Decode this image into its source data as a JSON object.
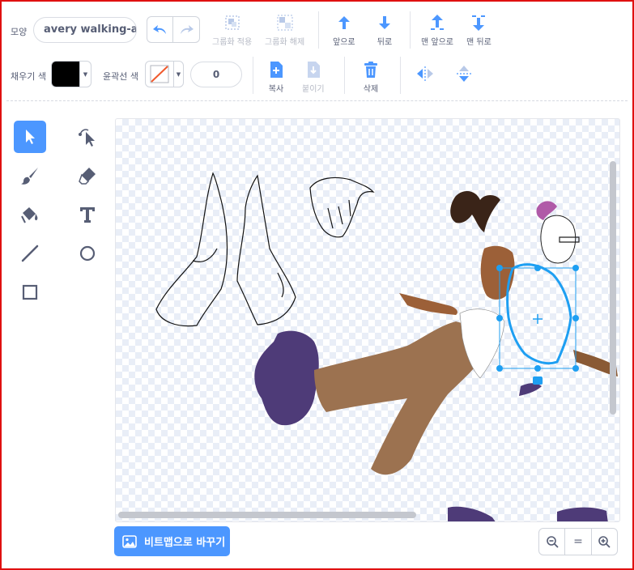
{
  "costume": {
    "label": "모양",
    "name": "avery walking-a"
  },
  "toolbar": {
    "group_label": "그룹화 적용",
    "ungroup_label": "그룹화 해제",
    "forward_label": "앞으로",
    "backward_label": "뒤로",
    "front_label": "맨 앞으로",
    "back_label": "맨 뒤로",
    "fill_label": "채우기 색",
    "outline_label": "윤곽선 색",
    "outline_width": "0",
    "copy_label": "복사",
    "paste_label": "붙이기",
    "delete_label": "삭제"
  },
  "colors": {
    "accent": "#4c97ff",
    "fill": "#000000",
    "no_outline": "#f0592c",
    "selection": "#1e9ff2"
  },
  "tools": [
    {
      "name": "select",
      "icon": "arrow-select-icon",
      "active": true
    },
    {
      "name": "reshape",
      "icon": "reshape-icon",
      "active": false
    },
    {
      "name": "brush",
      "icon": "brush-icon",
      "active": false
    },
    {
      "name": "eraser",
      "icon": "eraser-icon",
      "active": false
    },
    {
      "name": "fill",
      "icon": "fill-bucket-icon",
      "active": false
    },
    {
      "name": "text",
      "icon": "text-icon",
      "active": false
    },
    {
      "name": "line",
      "icon": "line-icon",
      "active": false
    },
    {
      "name": "circle",
      "icon": "circle-icon",
      "active": false
    },
    {
      "name": "rectangle",
      "icon": "rectangle-icon",
      "active": false
    }
  ],
  "bottom": {
    "convert_label": "비트맵으로 바꾸기",
    "zoom_reset": "="
  }
}
